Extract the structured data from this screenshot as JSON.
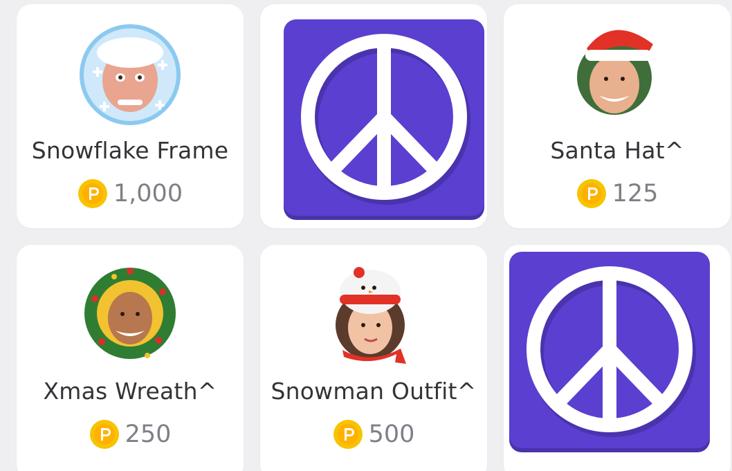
{
  "shop_items": [
    {
      "title": "Snowflake Frame",
      "price": "1,000",
      "avatar": "snowflake-frame-avatar"
    },
    {
      "ad_icon": "peace-sign-icon"
    },
    {
      "title": "Santa Hat^",
      "price": "125",
      "avatar": "santa-hat-avatar"
    },
    {
      "title": "Xmas Wreath^",
      "price": "250",
      "avatar": "xmas-wreath-avatar"
    },
    {
      "title": "Snowman Outfit^",
      "price": "500",
      "avatar": "snowman-outfit-avatar"
    },
    {
      "ad_icon": "peace-sign-icon"
    }
  ],
  "currency_icon": "coin-p-icon",
  "colors": {
    "background": "#efeff1",
    "card": "#ffffff",
    "ad_purple": "#5b3fd0",
    "coin_gold": "#f6c400",
    "title_text": "#333437",
    "price_text": "#7d8086"
  }
}
